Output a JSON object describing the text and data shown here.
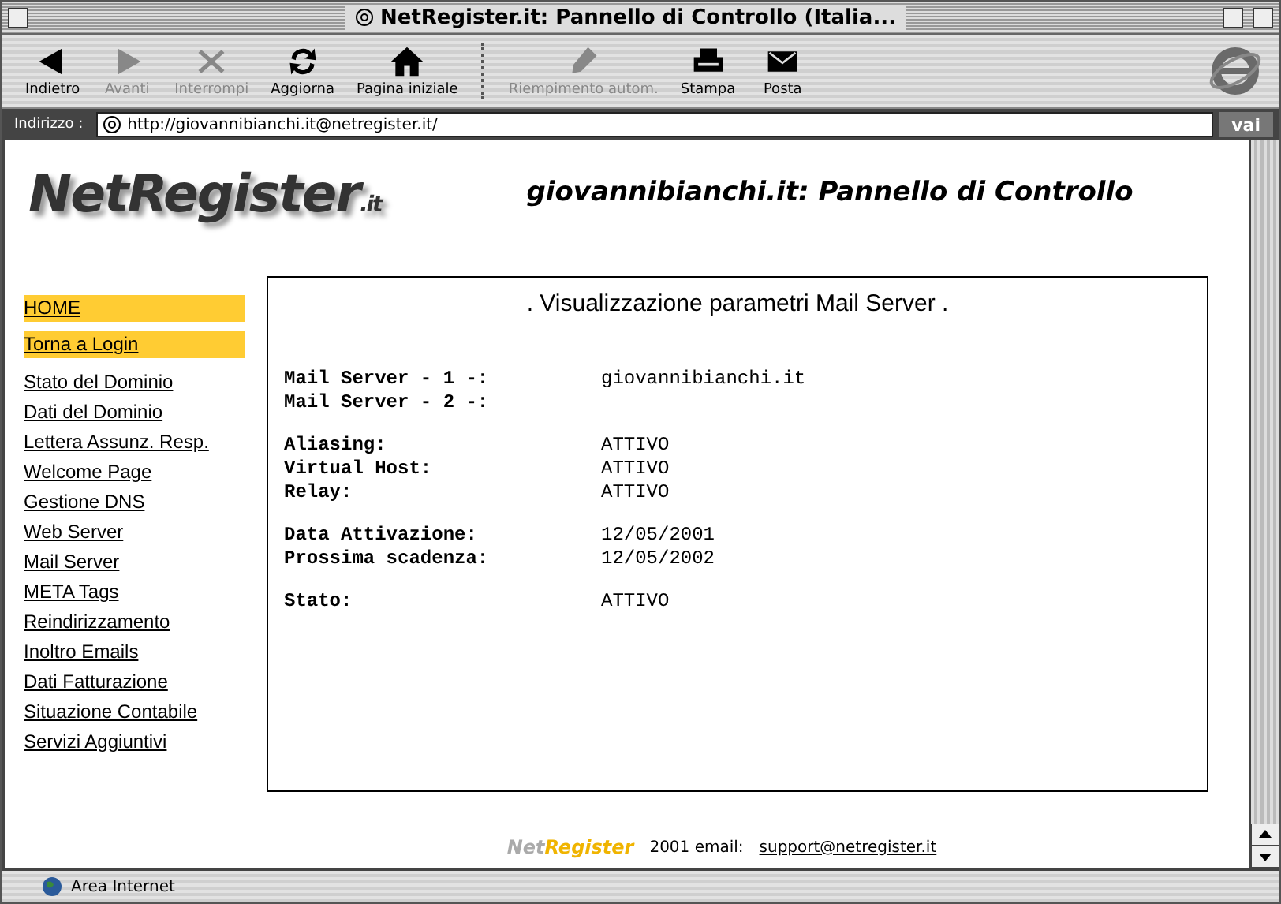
{
  "window": {
    "title": "NetRegister.it: Pannello di Controllo (Italia..."
  },
  "toolbar": [
    {
      "label": "Indietro",
      "kind": "back",
      "disabled": false
    },
    {
      "label": "Avanti",
      "kind": "forward",
      "disabled": true
    },
    {
      "label": "Interrompi",
      "kind": "stop",
      "disabled": true
    },
    {
      "label": "Aggiorna",
      "kind": "refresh",
      "disabled": false
    },
    {
      "label": "Pagina iniziale",
      "kind": "home",
      "disabled": false
    },
    {
      "kind": "separator"
    },
    {
      "label": "Riempimento autom.",
      "kind": "autofill",
      "disabled": true
    },
    {
      "label": "Stampa",
      "kind": "print",
      "disabled": false
    },
    {
      "label": "Posta",
      "kind": "mail",
      "disabled": false
    }
  ],
  "address_bar": {
    "label": "Indirizzo :",
    "value": "http://giovannibianchi.it@netregister.it/",
    "go": "vai"
  },
  "page": {
    "logo": {
      "name": "NetRegister",
      "suffix": ".it"
    },
    "title": "giovannibianchi.it: Pannello di Controllo",
    "menu": [
      {
        "label": "HOME",
        "highlighted": true
      },
      {
        "label": "Torna a Login",
        "highlighted": true
      },
      {
        "label": "Stato del Dominio",
        "highlighted": false
      },
      {
        "label": "Dati del Dominio",
        "highlighted": false
      },
      {
        "label": "Lettera Assunz. Resp.",
        "highlighted": false
      },
      {
        "label": "Welcome Page",
        "highlighted": false
      },
      {
        "label": "Gestione DNS",
        "highlighted": false
      },
      {
        "label": "Web Server",
        "highlighted": false
      },
      {
        "label": "Mail Server",
        "highlighted": false
      },
      {
        "label": "META Tags",
        "highlighted": false
      },
      {
        "label": "Reindirizzamento",
        "highlighted": false
      },
      {
        "label": "Inoltro Emails",
        "highlighted": false
      },
      {
        "label": "Dati Fatturazione",
        "highlighted": false
      },
      {
        "label": "Situazione Contabile",
        "highlighted": false
      },
      {
        "label": "Servizi Aggiuntivi",
        "highlighted": false
      }
    ],
    "panel": {
      "heading": ". Visualizzazione parametri Mail Server .",
      "groups": [
        [
          {
            "label": "Mail Server - 1 -:",
            "value": "giovannibianchi.it"
          },
          {
            "label": "Mail Server - 2 -:"
          }
        ],
        [
          {
            "label": "Aliasing:",
            "value": "ATTIVO"
          },
          {
            "label": "Virtual Host:",
            "value": "ATTIVO"
          },
          {
            "label": "Relay:",
            "value": "ATTIVO"
          }
        ],
        [
          {
            "label": "Data Attivazione:",
            "value": "12/05/2001"
          },
          {
            "label": "Prossima scadenza:",
            "value": "12/05/2002"
          }
        ],
        [
          {
            "label": "Stato:",
            "value": "ATTIVO"
          }
        ]
      ]
    },
    "footer": {
      "logo_a": "Net",
      "logo_b": "Register",
      "text": "2001 email:",
      "link": "support@netregister.it"
    }
  },
  "status_bar": {
    "zone": "Area Internet"
  }
}
